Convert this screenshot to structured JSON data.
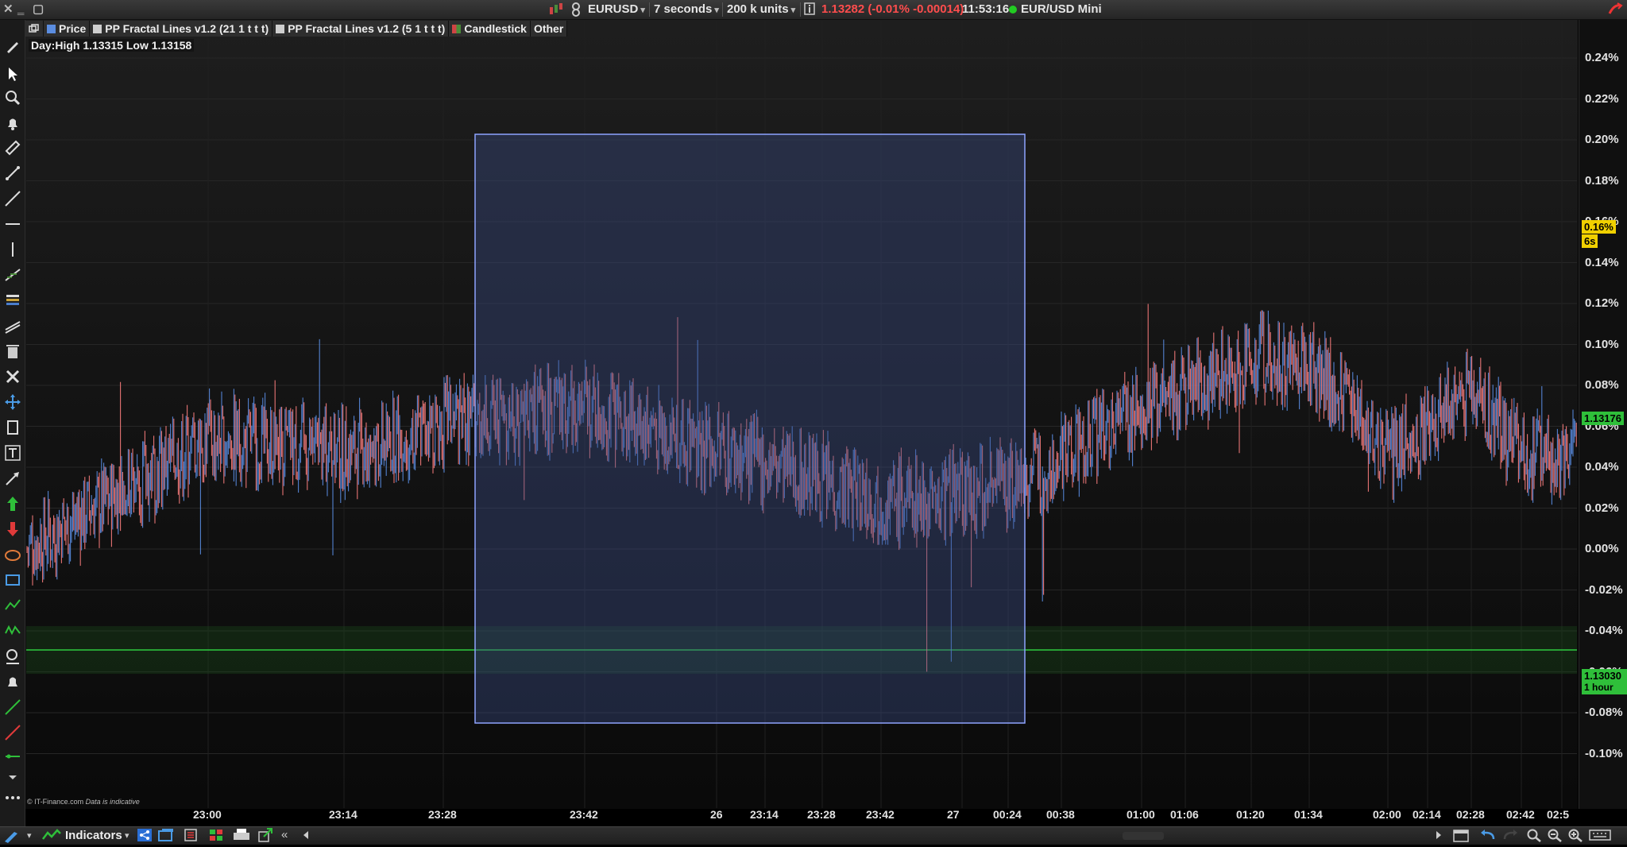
{
  "top_bar": {
    "symbol": "EURUSD",
    "interval": "7 seconds",
    "units": "200 k units",
    "price_change": "1.13282 (-0.01% -0.00014)",
    "time": "11:53:16",
    "instrument_name": "EUR/USD Mini",
    "colors": {
      "change": "#ff4d4d",
      "live_dot": "#22cc22"
    }
  },
  "legend": {
    "items": [
      {
        "label": "Price",
        "color": "#5b8de0"
      },
      {
        "label": "PP Fractal Lines v1.2 (21 1 t t t)",
        "color": "#cfcfcf"
      },
      {
        "label": "PP Fractal Lines v1.2 (5 1 t t t)",
        "color": "#cfcfcf"
      },
      {
        "label": "Candlestick",
        "color": "#cf4444"
      },
      {
        "label": "Other",
        "color": ""
      }
    ]
  },
  "day_range": "Day:High 1.13315 Low 1.13158",
  "y_axis": {
    "labels": [
      "0.24%",
      "0.22%",
      "0.20%",
      "0.18%",
      "0.16%",
      "0.14%",
      "0.12%",
      "0.10%",
      "0.08%",
      "0.06%",
      "0.04%",
      "0.02%",
      "0.00%",
      "-0.02%",
      "-0.04%",
      "-0.06%",
      "-0.08%",
      "-0.10%"
    ],
    "current_pct_tag": "0.16%",
    "countdown_tag": "6s",
    "price_tag": "1.13176",
    "level_tag_price": "1.13030",
    "level_tag_period": "1 hour"
  },
  "x_axis": {
    "labels": [
      "23:00",
      "23:14",
      "23:28",
      "23:42",
      "26",
      "23:14",
      "23:28",
      "23:42",
      "27",
      "00:24",
      "00:38",
      "01:00",
      "01:06",
      "01:20",
      "01:34",
      "02:00",
      "02:14",
      "02:28",
      "02:42",
      "02:5"
    ]
  },
  "footer": {
    "copyright": "© IT-Finance.com",
    "disclaimer": "Data is indicative",
    "indicators_label": "Indicators"
  },
  "colors": {
    "up": "#5b8fe6",
    "down": "#ff7f7f",
    "selection_fill": "#3a4a80",
    "selection_border": "#8ea3ff",
    "level_line": "#2ecc40"
  },
  "chart_data": {
    "type": "candlestick",
    "y_unit": "%",
    "ylim": [
      -0.11,
      0.25
    ],
    "anchor_points": [
      {
        "x": "start",
        "y": 0.0
      },
      {
        "x": "23:00",
        "y": 0.07
      },
      {
        "x": "23:14",
        "y": 0.06
      },
      {
        "x": "23:28",
        "y": 0.08
      },
      {
        "x": "23:42",
        "y": 0.09
      },
      {
        "x": "26 23:42",
        "y": 0.03
      },
      {
        "x": "27 00:24",
        "y": 0.04
      },
      {
        "x": "01:00",
        "y": 0.09
      },
      {
        "x": "01:20",
        "y": 0.12
      },
      {
        "x": "01:34",
        "y": 0.12
      },
      {
        "x": "02:00",
        "y": 0.06
      },
      {
        "x": "02:28",
        "y": 0.1
      },
      {
        "x": "02:42",
        "y": 0.06
      },
      {
        "x": "end",
        "y": 0.06
      }
    ],
    "day_high": 1.13315,
    "day_low": 1.13158,
    "horizontal_level": {
      "price": 1.1303,
      "period": "1 hour",
      "pct": -0.065
    }
  }
}
